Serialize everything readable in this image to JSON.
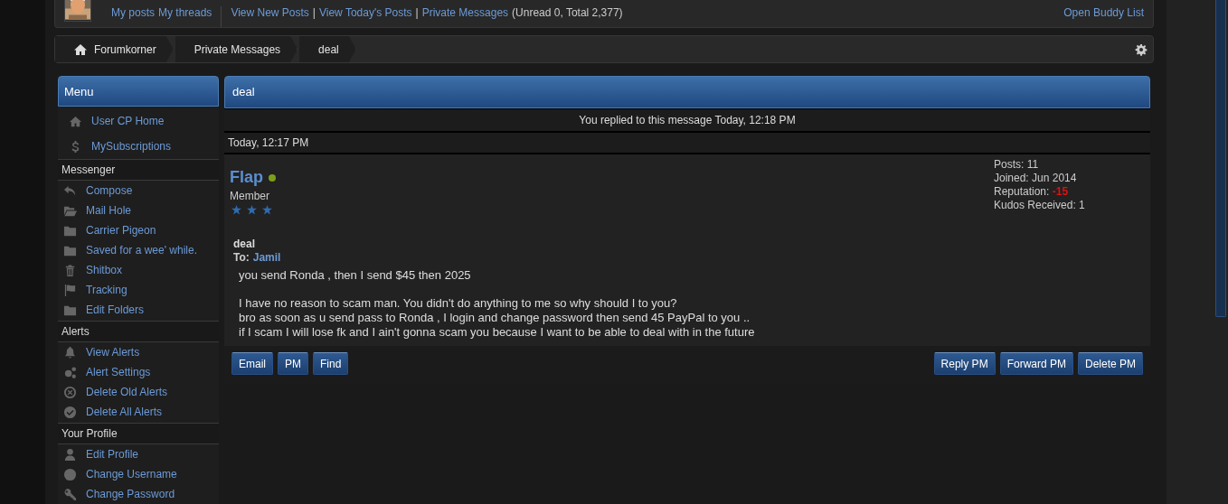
{
  "header": {
    "user_links": [
      "My posts",
      "My threads"
    ],
    "bottom_line": [
      {
        "text": "View New Posts",
        "kind": "link"
      },
      {
        "text": "|",
        "kind": "text"
      },
      {
        "text": "View Today's Posts",
        "kind": "link"
      },
      {
        "text": "|",
        "kind": "text"
      },
      {
        "text": "Private Messages",
        "kind": "link"
      },
      {
        "text": "(Unread 0, Total 2,377)",
        "kind": "text"
      }
    ],
    "buddy_link": "Open Buddy List"
  },
  "breadcrumb": [
    {
      "label": "Forumkorner"
    },
    {
      "label": "Private Messages"
    },
    {
      "label": "deal"
    }
  ],
  "sidebar": {
    "title": "Menu",
    "top_items": [
      {
        "label": "User CP Home"
      },
      {
        "label": "MySubscriptions"
      }
    ],
    "sections": [
      {
        "title": "Messenger",
        "items": [
          {
            "label": "Compose"
          },
          {
            "label": "Mail Hole"
          },
          {
            "label": "Carrier Pigeon"
          },
          {
            "label": "Saved for a wee' while."
          },
          {
            "label": "Shitbox"
          },
          {
            "label": "Tracking"
          },
          {
            "label": "Edit Folders"
          }
        ]
      },
      {
        "title": "Alerts",
        "items": [
          {
            "label": "View Alerts"
          },
          {
            "label": "Alert Settings"
          },
          {
            "label": "Delete Old Alerts"
          },
          {
            "label": "Delete All Alerts"
          }
        ]
      },
      {
        "title": "Your Profile",
        "items": [
          {
            "label": "Edit Profile"
          },
          {
            "label": "Change Username"
          },
          {
            "label": "Change Password"
          }
        ]
      }
    ]
  },
  "message": {
    "title": "deal",
    "notice": "You replied to this message Today, 12:18 PM",
    "date": "Today, 12:17 PM",
    "author": {
      "name": "Flap",
      "online": true,
      "rank": "Member",
      "stars": 3
    },
    "stats": [
      {
        "label": "Posts:",
        "value": "11",
        "kind": "plain"
      },
      {
        "label": "Joined:",
        "value": "Jun 2014",
        "kind": "plain"
      },
      {
        "label": "Reputation:",
        "value": "-15",
        "kind": "negative"
      },
      {
        "label": "Kudos Received:",
        "value": "1",
        "kind": "plain"
      }
    ],
    "subject": "deal",
    "to_label": "To:",
    "to": "Jamil",
    "paragraphs": [
      [
        "you send Ronda , then I send $45 then 2025"
      ],
      [
        "I have no reason to scam man. You didn't do anything to me so why should I to you?",
        "bro as soon as u send pass to Ronda , I login and change password then send 45 PayPal to you ..",
        "if I scam I will lose fk and I ain't gonna scam you because I want to be able to deal with in the future"
      ]
    ],
    "buttons_left": [
      "Email",
      "PM",
      "Find"
    ],
    "buttons_right": [
      "Reply PM",
      "Forward PM",
      "Delete PM"
    ]
  }
}
